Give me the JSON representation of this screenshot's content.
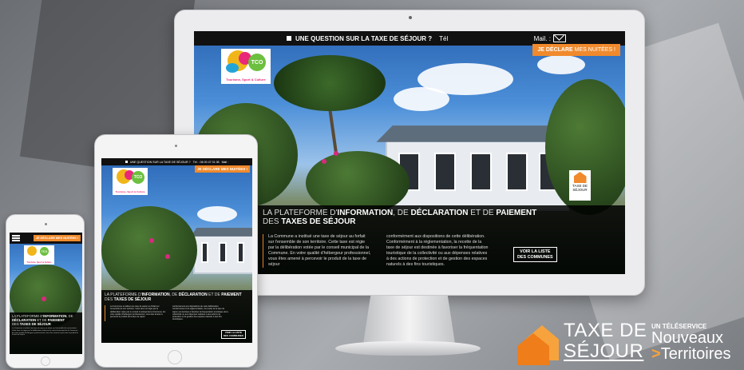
{
  "monitor": {
    "topbar": {
      "question": "UNE QUESTION SUR LA TAXE DE SÉJOUR ?",
      "tel": "Tél",
      "mail": "Mail. :"
    },
    "declare": {
      "bold": "JE DÉCLARE",
      "rest": "MES NUITÉES !"
    },
    "logo": {
      "badge": "TCO",
      "tagline": "Tourisme, Sport & Culture"
    },
    "badge": {
      "line1": "TAXE DE",
      "line2": "SÉJOUR"
    },
    "headline": {
      "p1": "LA PLATEFORME D'",
      "b1": "INFORMATION",
      "p2": ", DE ",
      "b2": "DÉCLARATION",
      "p3": " ET DE ",
      "b3": "PAIEMENT",
      "p4": "DES ",
      "b4": "TAXES DE SÉJOUR"
    },
    "col1": "La Commune a institué une taxe de séjour au forfait sur l'ensemble de son territoire. Cette taxe est régie par la délibération votée par le conseil municipal de la Commune. En votre qualité d'hébergeur professionnel, vous êtes amené à percevoir le produit de la taxe de séjour",
    "col2": "conformément aux dispositions de cette délibération. Conformément à la réglementation, la recette de la taxe de séjour est destinée à favoriser la fréquentation touristique de la collectivité ou aux dépenses relatives à des actions de protection et de gestion des espaces naturels à des fins touristiques.",
    "list_button": {
      "line1": "VOIR LA LISTE",
      "line2": "DES COMMUNES"
    }
  },
  "tablet": {
    "topbar": {
      "question": "UNE QUESTION SUR LA TAXE DE SÉJOUR ?",
      "tel": "Tél. : 06 00 47 01 08",
      "mail": "Mail :"
    },
    "declare": "JE DÉCLARE MES NUITÉES !",
    "list_button": {
      "line1": "VOIR LA LISTE",
      "line2": "DES COMMUNES"
    }
  },
  "phone": {
    "declare": "JE DÉCLARE MES NUITÉES !"
  },
  "brand": {
    "line1": "TAXE DE",
    "line2": "SÉJOUR",
    "service": "UN TÉLÉSERVICE",
    "name1": "Nouveaux",
    "name2": "Territoires",
    "chevron": ">"
  },
  "colors": {
    "accent": "#f08a2c",
    "pink": "#e9287a",
    "dark": "#111111"
  }
}
